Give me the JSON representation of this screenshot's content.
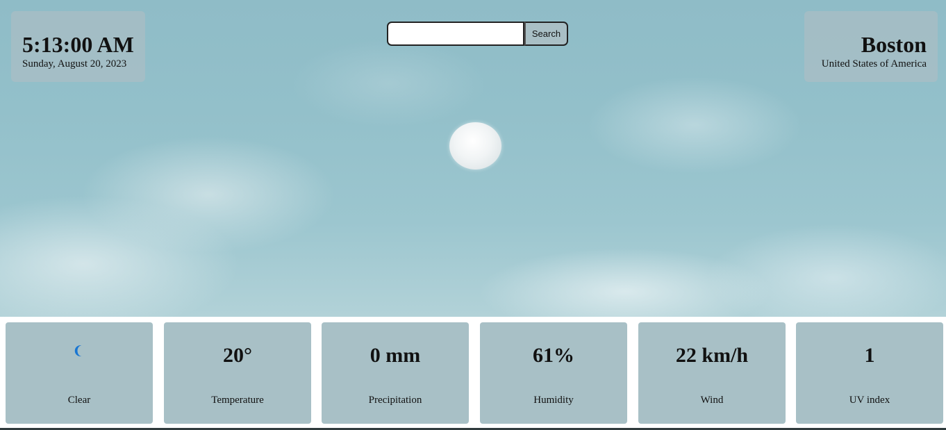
{
  "clock": {
    "time": "5:13:00 AM",
    "date": "Sunday, August 20, 2023"
  },
  "search": {
    "value": "",
    "placeholder": "",
    "button_label": "Search"
  },
  "location": {
    "city": "Boston",
    "country": "United States of America"
  },
  "conditions": {
    "icon": "crescent-moon-icon",
    "icon_color": "#1976d2",
    "label": "Clear"
  },
  "stats": [
    {
      "value": "20°",
      "label": "Temperature"
    },
    {
      "value": "0 mm",
      "label": "Precipitation"
    },
    {
      "value": "61%",
      "label": "Humidity"
    },
    {
      "value": "22 km/h",
      "label": "Wind"
    },
    {
      "value": "1",
      "label": "UV index"
    }
  ]
}
